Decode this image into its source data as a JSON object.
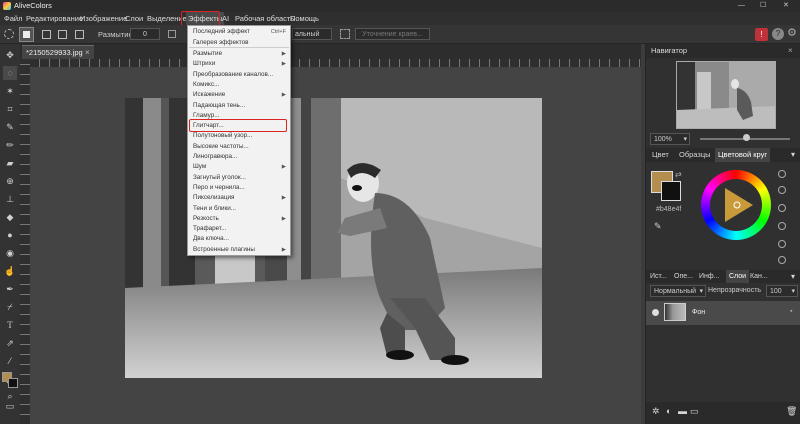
{
  "app": {
    "title": "AliveColors"
  },
  "window_controls": {
    "minimize": "—",
    "maximize": "☐",
    "close": "✕"
  },
  "menubar": {
    "items": [
      "Файл",
      "Редактирование",
      "Изображение",
      "Слои",
      "Выделение",
      "Эффекты",
      "AI",
      "Рабочая область",
      "Помощь"
    ]
  },
  "tool_options": {
    "blur_label": "Размытие",
    "blur_value": "0",
    "mode_value": "альный",
    "refine_button": "Уточнение краев..."
  },
  "document": {
    "tab_title": "*2150529933.jpg",
    "close": "×"
  },
  "effects_menu": {
    "items": [
      {
        "label": "Последний эффект",
        "shortcut": "Ctrl+F"
      },
      {
        "label": "Галерея эффектов"
      },
      {
        "label": "Размытие",
        "submenu": "true"
      },
      {
        "label": "Штрихи",
        "submenu": "true"
      },
      {
        "label": "Преобразование каналов..."
      },
      {
        "label": "Комикс..."
      },
      {
        "label": "Искажение",
        "submenu": "true"
      },
      {
        "label": "Падающая тень..."
      },
      {
        "label": "Гламур..."
      },
      {
        "label": "Глитчарт..."
      },
      {
        "label": "Полутоновый узор..."
      },
      {
        "label": "Высокие частоты..."
      },
      {
        "label": "Линогравюра..."
      },
      {
        "label": "Шум",
        "submenu": "true"
      },
      {
        "label": "Загнутый уголок..."
      },
      {
        "label": "Перо и чернила..."
      },
      {
        "label": "Пикселизация",
        "submenu": "true"
      },
      {
        "label": "Тени и блики..."
      },
      {
        "label": "Резкость",
        "submenu": "true"
      },
      {
        "label": "Трафарет..."
      },
      {
        "label": "Два ключа..."
      },
      {
        "label": "Встроенные плагины",
        "submenu": "true"
      }
    ],
    "highlighted": "Глитчарт..."
  },
  "navigator": {
    "title": "Навигатор",
    "zoom": "100%"
  },
  "color_panel": {
    "tabs": [
      "Цвет",
      "Образцы",
      "Цветовой круг"
    ],
    "hex": "#b48e4f",
    "fg_color": "#b48e4f",
    "bg_color": "#111111"
  },
  "layers_panel": {
    "tabs": [
      "Ист...",
      "Опе...",
      "Инф...",
      "Слои",
      "Кан..."
    ],
    "blend_mode": "Нормальный",
    "opacity_label": "Непрозрачность",
    "opacity_value": "100",
    "layer_name": "Фон"
  },
  "accent": {
    "highlight_red": "#d22222"
  }
}
